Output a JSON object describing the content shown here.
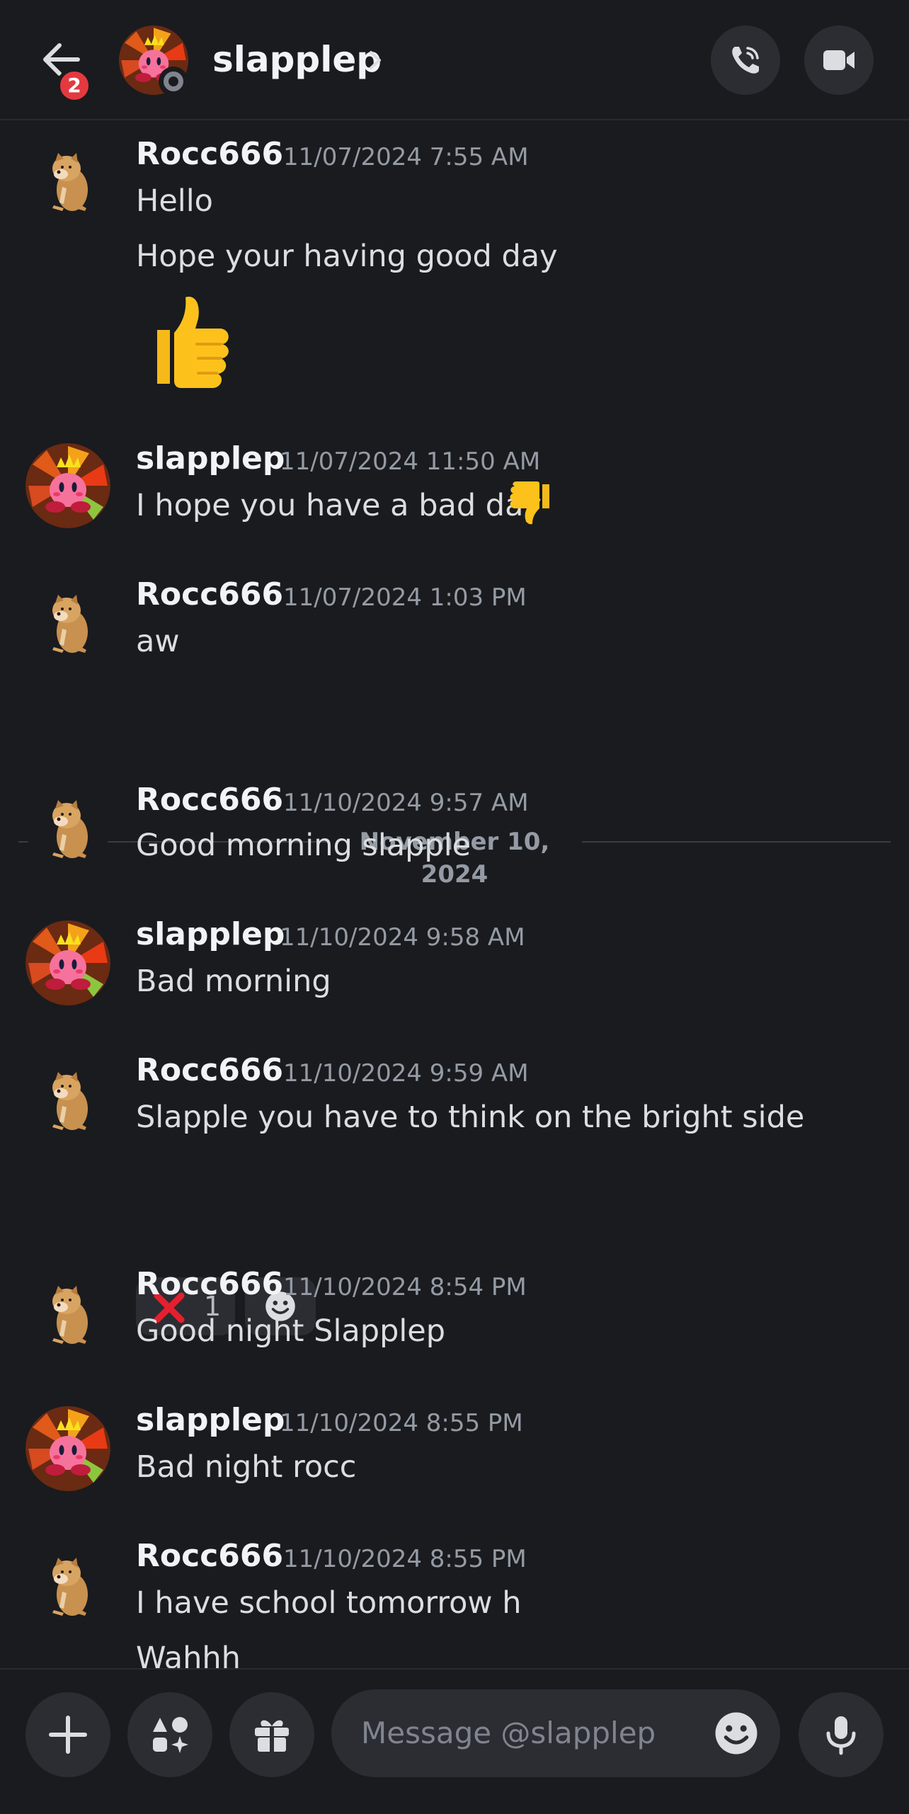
{
  "header": {
    "title": "slapplep",
    "notification_count": "2",
    "icons": {
      "back": "arrow-left-icon",
      "chevron": "chevron-right-icon",
      "call": "phone-call-icon",
      "video": "video-camera-icon"
    },
    "status": "offline"
  },
  "messages": [
    {
      "author": "Rocc666",
      "timestamp": "11/07/2024 7:55 AM",
      "lines": [
        "Hello",
        "Hope your having good day"
      ],
      "emoji": "thumbs-up"
    },
    {
      "author": "slapplep",
      "timestamp": "11/07/2024 11:50 AM",
      "lines": [
        "I hope you have a bad day"
      ],
      "inline_emoji": "thumbs-down"
    },
    {
      "author": "Rocc666",
      "timestamp": "11/07/2024 1:03 PM",
      "lines": [
        "aw"
      ]
    },
    {
      "author": "Rocc666",
      "timestamp": "11/10/2024 9:57 AM",
      "lines": [
        "Good morning slapple"
      ]
    },
    {
      "author": "slapplep",
      "timestamp": "11/10/2024 9:58 AM",
      "lines": [
        "Bad morning"
      ]
    },
    {
      "author": "Rocc666",
      "timestamp": "11/10/2024 9:59 AM",
      "lines": [
        "Slapple you have to think on the bright side"
      ],
      "reactions": [
        {
          "emoji": "cross-mark",
          "count": "1"
        }
      ]
    },
    {
      "author": "Rocc666",
      "timestamp": "11/10/2024 8:54 PM",
      "lines": [
        "Good night Slapplep"
      ]
    },
    {
      "author": "slapplep",
      "timestamp": "11/10/2024 8:55 PM",
      "lines": [
        "Bad night rocc"
      ]
    },
    {
      "author": "Rocc666",
      "timestamp": "11/10/2024 8:55 PM",
      "lines": [
        "I have school tomorrow h",
        "Wahhh"
      ]
    }
  ],
  "date_divider": "November 10, 2024",
  "composer": {
    "placeholder": "Message @slapplep",
    "icons": {
      "add": "plus-icon",
      "apps": "apps-icon",
      "gift": "gift-icon",
      "emoji": "emoji-icon",
      "mic": "microphone-icon"
    }
  },
  "colors": {
    "background": "#1a1b1f",
    "surface": "#2b2d33",
    "badge": "#e4393f",
    "muted_text": "#949ba4",
    "primary_text": "#f2f3f5"
  }
}
